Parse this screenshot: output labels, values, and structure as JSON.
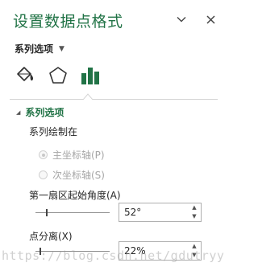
{
  "pane": {
    "title": "设置数据点格式",
    "options_icon": "chevron-down-icon",
    "close_icon": "close-icon",
    "close_glyph": "✕",
    "options_glyph": "⌄"
  },
  "series_dropdown": {
    "label": "系列选项",
    "caret": "▼"
  },
  "tabs": [
    {
      "name": "fill-line",
      "icon": "paint-bucket-icon"
    },
    {
      "name": "effects",
      "icon": "pentagon-icon"
    },
    {
      "name": "series-options",
      "icon": "bar-chart-icon",
      "active": true
    }
  ],
  "section": {
    "title": "系列选项",
    "triangle": "◢",
    "plot_on_label": "系列绘制在",
    "primary_axis": "主坐标轴(P)",
    "secondary_axis": "次坐标轴(S)",
    "primary_checked": true,
    "first_slice_label": "第一扇区起始角度(A)",
    "first_slice_value": "52°",
    "first_slice_fraction": 0.144,
    "explosion_label": "点分离(X)",
    "explosion_value": "22%",
    "explosion_fraction": 0.05
  },
  "spin": {
    "up": "▲",
    "down": "▼"
  },
  "watermark": "https://blog.csdn.net/gdutryy",
  "colors": {
    "accent": "#217346",
    "text": "#262626",
    "disabled": "#a6a6a6"
  }
}
